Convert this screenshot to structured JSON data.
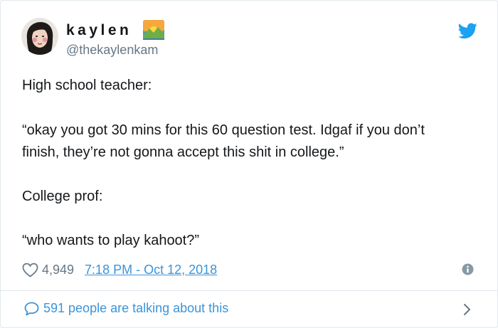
{
  "author": {
    "display_name": "kaylen",
    "handle": "@thekaylenkam",
    "name_emoji": "sunrise-over-mountains-emoji"
  },
  "tweet": {
    "lines": [
      "High school teacher:",
      "“okay you got 30 mins for this 60 question test. Idgaf if you don’t",
      "finish, they’re not gonna accept this shit in college.”",
      "College prof:",
      "“who wants to play kahoot?”"
    ]
  },
  "meta": {
    "like_count": "4,949",
    "timestamp": "7:18 PM - Oct 12, 2018"
  },
  "footer": {
    "talking_text": "591 people are talking about this"
  },
  "colors": {
    "text": "#14171a",
    "secondary": "#657786",
    "link": "#3b94d9",
    "twitter_blue": "#1da1f2",
    "border": "#e1e8ed"
  },
  "icons": [
    "twitter-bird-icon",
    "heart-icon",
    "info-icon",
    "reply-bubble-icon",
    "chevron-right-icon"
  ]
}
